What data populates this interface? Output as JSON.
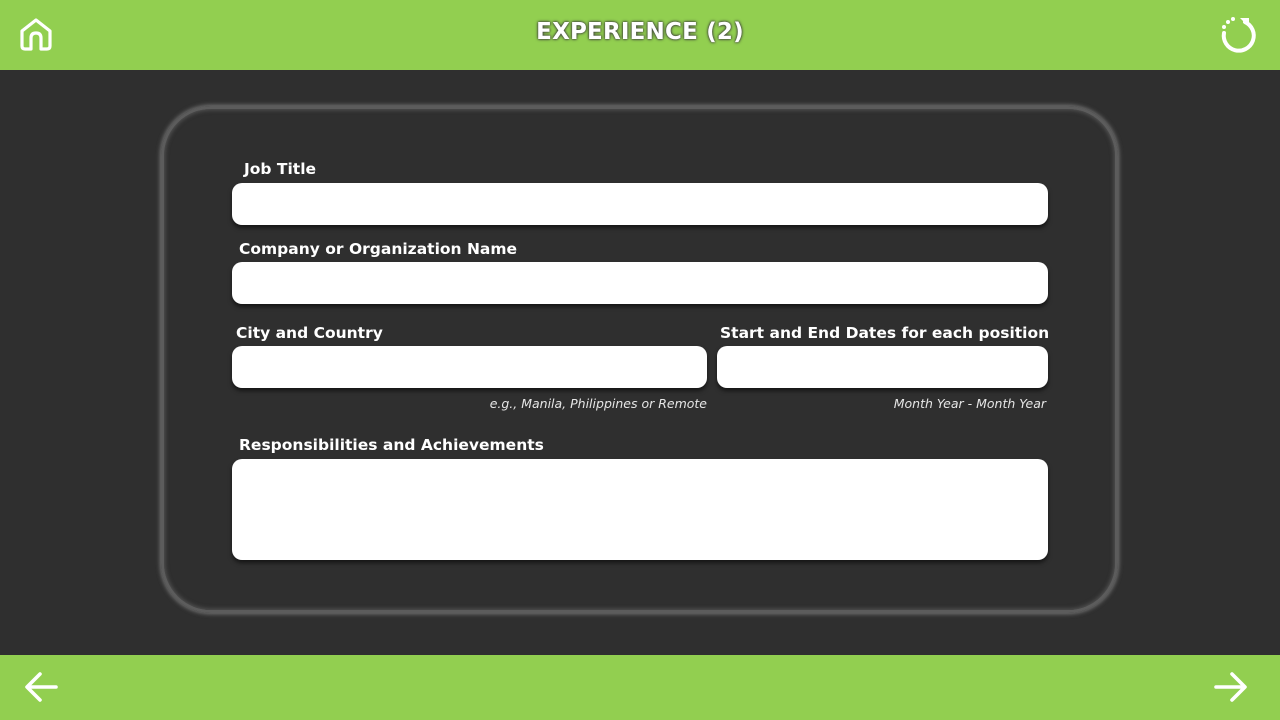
{
  "header": {
    "title": "EXPERIENCE (2)"
  },
  "icons": {
    "home": "home-icon",
    "reset": "reset-icon",
    "back": "arrow-left-icon",
    "next": "arrow-right-icon"
  },
  "colors": {
    "bar": "#92cf50",
    "background": "#2f2f2f",
    "field": "#ffffff"
  },
  "form": {
    "job_title": {
      "label": "Job Title",
      "value": ""
    },
    "company": {
      "label": "Company or Organization Name",
      "value": ""
    },
    "city_country": {
      "label": "City and Country",
      "value": "",
      "hint": "e.g., Manila, Philippines or Remote"
    },
    "dates": {
      "label": "Start and End Dates for each position",
      "value": "",
      "hint": "Month Year - Month Year"
    },
    "responsibilities": {
      "label": "Responsibilities and Achievements",
      "value": ""
    }
  }
}
